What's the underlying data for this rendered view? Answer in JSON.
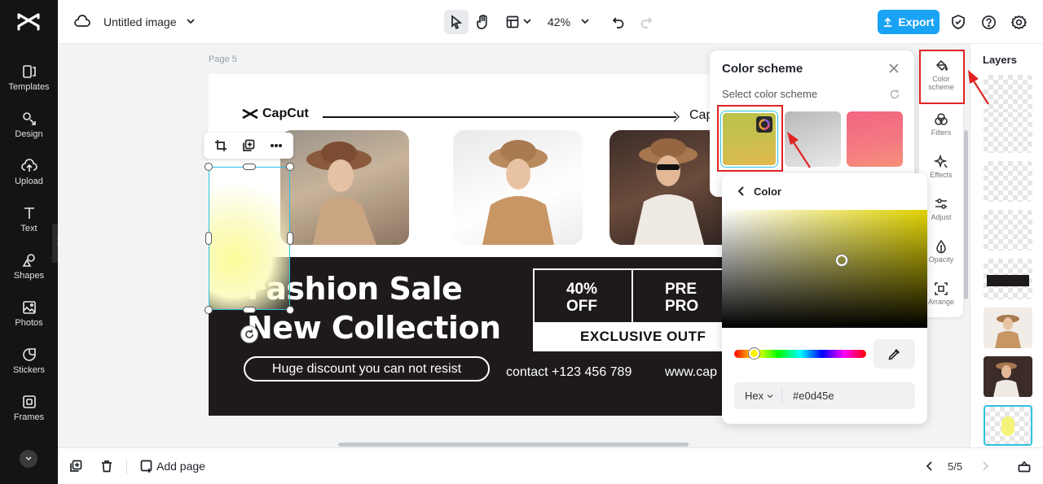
{
  "app": {
    "document_title": "Untitled image",
    "zoom": "42%",
    "export_label": "Export",
    "page_label": "Page 5",
    "page_count": "5/5",
    "add_page_label": "Add page"
  },
  "sidebar": {
    "items": [
      {
        "label": "Templates",
        "icon": "templates-icon"
      },
      {
        "label": "Design",
        "icon": "design-icon"
      },
      {
        "label": "Upload",
        "icon": "upload-icon"
      },
      {
        "label": "Text",
        "icon": "text-icon"
      },
      {
        "label": "Shapes",
        "icon": "shapes-icon"
      },
      {
        "label": "Photos",
        "icon": "photos-icon"
      },
      {
        "label": "Stickers",
        "icon": "stickers-icon"
      },
      {
        "label": "Frames",
        "icon": "frames-icon"
      }
    ]
  },
  "design": {
    "brand": "CapCut",
    "brand_right": "Cap",
    "headline_1": "Fashion Sale",
    "headline_2": "New Collection",
    "pill": "Huge discount you can not resist",
    "contact": "contact +123 456 789",
    "website": "www.cap",
    "offer_left_1": "40%",
    "offer_left_2": "OFF",
    "offer_right_1": "PRE",
    "offer_right_2": "PRO",
    "exclusive": "EXCLUSIVE OUTF"
  },
  "color_scheme_panel": {
    "title": "Color scheme",
    "subtitle": "Select color scheme",
    "swatches": [
      {
        "from": "#b9c24a",
        "to": "#e2b84e"
      },
      {
        "from": "#b8b8b8",
        "to": "#e8e8e8"
      },
      {
        "from": "#f2667f",
        "to": "#f6907a"
      }
    ]
  },
  "color_picker": {
    "title": "Color",
    "mode": "Hex",
    "value": "#e0d45e"
  },
  "tools": [
    {
      "label": "Color scheme",
      "icon": "paint-bucket-icon"
    },
    {
      "label": "Filters",
      "icon": "filters-icon"
    },
    {
      "label": "Effects",
      "icon": "effects-icon"
    },
    {
      "label": "Adjust",
      "icon": "adjust-icon"
    },
    {
      "label": "Opacity",
      "icon": "opacity-icon"
    },
    {
      "label": "Arrange",
      "icon": "arrange-icon"
    }
  ],
  "layers": {
    "title": "Layers"
  },
  "colors": {
    "accent": "#19a3f5",
    "selection": "#2dc2e0",
    "annotation": "#e02424",
    "dark_band": "#1e1a1b"
  }
}
